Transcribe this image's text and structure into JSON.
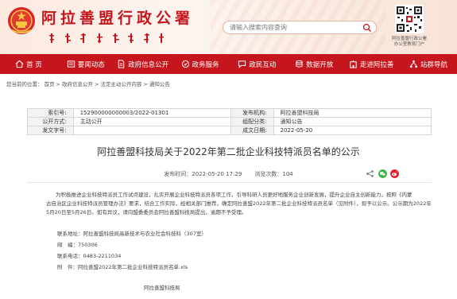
{
  "header": {
    "site_title": "阿拉善盟行政公署",
    "search_placeholder": "请输入搜索内容查询",
    "qr_label_line1": "阿拉善盟行政公署",
    "qr_label_line2": "办公室教育门户",
    "brand_color": "#c5161d"
  },
  "nav": {
    "items": [
      {
        "label": "首 页",
        "icon": "home-icon"
      },
      {
        "label": "要闻动态",
        "icon": "news-icon"
      },
      {
        "label": "政府信息公开",
        "icon": "document-icon"
      },
      {
        "label": "政务服务",
        "icon": "service-icon"
      },
      {
        "label": "政民互动",
        "icon": "chat-icon"
      },
      {
        "label": "数据开放",
        "icon": "data-icon"
      },
      {
        "label": "走进阿拉善",
        "icon": "building-icon"
      },
      {
        "label": "站群导航",
        "icon": "network-icon"
      }
    ]
  },
  "breadcrumb": {
    "prefix": "您当前的位置：",
    "items": [
      "首页",
      "政府信息公开",
      "法定主动公开内容",
      "通知公告"
    ],
    "separator": ">"
  },
  "info": {
    "rows": [
      {
        "l1": "索引号:",
        "v1": "152900000000003/2022-01301",
        "l2": "发布机构:",
        "v2": "阿拉善盟科技局"
      },
      {
        "l1": "公开方式:",
        "v1": "主动公开",
        "l2": "组配分类:",
        "v2": "通知公告"
      },
      {
        "l1": "发文字号:",
        "v1": "",
        "l2": "成文日期:",
        "v2": "2022-05-20"
      }
    ]
  },
  "article": {
    "title": "阿拉善盟科技局关于2022年第二批企业科技特派员名单的公示",
    "publish_time": "发布时间：2022-05-20 17:29",
    "views": "浏览次数：104",
    "para_lines": [
      "为积极推进企业科技特派员工作试点建设，扎实开展企业科技特派员各项工作，引导科研人员更好地服务企业创新发展，提升企业自主创新能力，按照《内蒙",
      "古自治区企业科技特派员管理办法》要求，结合工作实际，经相关部门推荐，确定阿拉善盟2022年第二批企业科技特派员名单（见附件），现予以公示。公示期为2022年",
      "5月20日至5月26日。如有异议，请向盟委委员会阿拉善盟科技局提出，逾期不予受理。"
    ],
    "contact_address": "联系地址：阿拉善盟科技局高新技术与农业社会科技科（307室）",
    "postcode": "邮　编：750306",
    "phone": "联系电话：0483-2211034",
    "attachment": "附　件：阿拉善盟2022年第二批企业科技特派员名单.xls",
    "signature": "阿拉善盟科技局"
  }
}
